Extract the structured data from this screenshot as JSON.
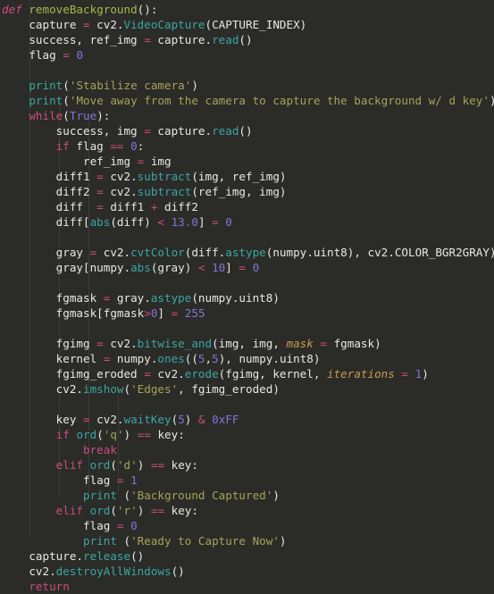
{
  "editor": {
    "language": "Python",
    "background_color": "#2b2b28",
    "foreground_color": "#e8e8e3",
    "font_size_px": 12.6,
    "line_height_px": 17,
    "theme_colors": {
      "keyword": "#cc4e7e",
      "function_name": "#a9b84a",
      "method_call": "#3ba7a0",
      "string": "#a5a458",
      "number": "#8675d6",
      "operator": "#cc4e7e",
      "keyword_argument": "#c99a4e",
      "plain_text": "#e8e8e3",
      "indent_guide": "#3b3b37"
    }
  },
  "code": {
    "lines": [
      [
        {
          "t": "def",
          "c": "kw-i"
        },
        {
          "t": " ",
          "c": "plain"
        },
        {
          "t": "removeBackground",
          "c": "fn"
        },
        {
          "t": "():",
          "c": "punct"
        }
      ],
      [
        {
          "t": "    capture ",
          "c": "plain"
        },
        {
          "t": "=",
          "c": "op"
        },
        {
          "t": " cv2.",
          "c": "plain"
        },
        {
          "t": "VideoCapture",
          "c": "meth"
        },
        {
          "t": "(CAPTURE_INDEX)",
          "c": "plain"
        }
      ],
      [
        {
          "t": "    success, ref_img ",
          "c": "plain"
        },
        {
          "t": "=",
          "c": "op"
        },
        {
          "t": " capture.",
          "c": "plain"
        },
        {
          "t": "read",
          "c": "meth"
        },
        {
          "t": "()",
          "c": "plain"
        }
      ],
      [
        {
          "t": "    flag ",
          "c": "plain"
        },
        {
          "t": "=",
          "c": "op"
        },
        {
          "t": " ",
          "c": "plain"
        },
        {
          "t": "0",
          "c": "num"
        }
      ],
      [],
      [
        {
          "t": "    ",
          "c": "plain"
        },
        {
          "t": "print",
          "c": "meth"
        },
        {
          "t": "(",
          "c": "plain"
        },
        {
          "t": "'Stabilize camera'",
          "c": "str"
        },
        {
          "t": ")",
          "c": "plain"
        }
      ],
      [
        {
          "t": "    ",
          "c": "plain"
        },
        {
          "t": "print",
          "c": "meth"
        },
        {
          "t": "(",
          "c": "plain"
        },
        {
          "t": "'Move away from the camera to capture the background w/ d key'",
          "c": "str"
        },
        {
          "t": ")",
          "c": "plain"
        }
      ],
      [
        {
          "t": "    ",
          "c": "plain"
        },
        {
          "t": "while",
          "c": "kw"
        },
        {
          "t": "(",
          "c": "plain"
        },
        {
          "t": "True",
          "c": "const"
        },
        {
          "t": "):",
          "c": "plain"
        }
      ],
      [
        {
          "t": "        success, img ",
          "c": "plain"
        },
        {
          "t": "=",
          "c": "op"
        },
        {
          "t": " capture.",
          "c": "plain"
        },
        {
          "t": "read",
          "c": "meth"
        },
        {
          "t": "()",
          "c": "plain"
        }
      ],
      [
        {
          "t": "        ",
          "c": "plain"
        },
        {
          "t": "if",
          "c": "kw"
        },
        {
          "t": " flag ",
          "c": "plain"
        },
        {
          "t": "==",
          "c": "op"
        },
        {
          "t": " ",
          "c": "plain"
        },
        {
          "t": "0",
          "c": "num"
        },
        {
          "t": ":",
          "c": "plain"
        }
      ],
      [
        {
          "t": "            ref_img ",
          "c": "plain"
        },
        {
          "t": "=",
          "c": "op"
        },
        {
          "t": " img",
          "c": "plain"
        }
      ],
      [
        {
          "t": "        diff1 ",
          "c": "plain"
        },
        {
          "t": "=",
          "c": "op"
        },
        {
          "t": " cv2.",
          "c": "plain"
        },
        {
          "t": "subtract",
          "c": "meth"
        },
        {
          "t": "(img, ref_img)",
          "c": "plain"
        }
      ],
      [
        {
          "t": "        diff2 ",
          "c": "plain"
        },
        {
          "t": "=",
          "c": "op"
        },
        {
          "t": " cv2.",
          "c": "plain"
        },
        {
          "t": "subtract",
          "c": "meth"
        },
        {
          "t": "(ref_img, img)",
          "c": "plain"
        }
      ],
      [
        {
          "t": "        diff  ",
          "c": "plain"
        },
        {
          "t": "=",
          "c": "op"
        },
        {
          "t": " diff1 ",
          "c": "plain"
        },
        {
          "t": "+",
          "c": "op"
        },
        {
          "t": " diff2",
          "c": "plain"
        }
      ],
      [
        {
          "t": "        diff[",
          "c": "plain"
        },
        {
          "t": "abs",
          "c": "meth"
        },
        {
          "t": "(diff) ",
          "c": "plain"
        },
        {
          "t": "<",
          "c": "op"
        },
        {
          "t": " ",
          "c": "plain"
        },
        {
          "t": "13.0",
          "c": "num"
        },
        {
          "t": "] ",
          "c": "plain"
        },
        {
          "t": "=",
          "c": "op"
        },
        {
          "t": " ",
          "c": "plain"
        },
        {
          "t": "0",
          "c": "num"
        }
      ],
      [],
      [
        {
          "t": "        gray ",
          "c": "plain"
        },
        {
          "t": "=",
          "c": "op"
        },
        {
          "t": " cv2.",
          "c": "plain"
        },
        {
          "t": "cvtColor",
          "c": "meth"
        },
        {
          "t": "(diff.",
          "c": "plain"
        },
        {
          "t": "astype",
          "c": "meth"
        },
        {
          "t": "(numpy.uint8), cv2.COLOR_BGR2GRAY)",
          "c": "plain"
        }
      ],
      [
        {
          "t": "        gray[numpy.",
          "c": "plain"
        },
        {
          "t": "abs",
          "c": "meth"
        },
        {
          "t": "(gray) ",
          "c": "plain"
        },
        {
          "t": "<",
          "c": "op"
        },
        {
          "t": " ",
          "c": "plain"
        },
        {
          "t": "10",
          "c": "num"
        },
        {
          "t": "] ",
          "c": "plain"
        },
        {
          "t": "=",
          "c": "op"
        },
        {
          "t": " ",
          "c": "plain"
        },
        {
          "t": "0",
          "c": "num"
        }
      ],
      [],
      [
        {
          "t": "        fgmask ",
          "c": "plain"
        },
        {
          "t": "=",
          "c": "op"
        },
        {
          "t": " gray.",
          "c": "plain"
        },
        {
          "t": "astype",
          "c": "meth"
        },
        {
          "t": "(numpy.uint8)",
          "c": "plain"
        }
      ],
      [
        {
          "t": "        fgmask[fgmask",
          "c": "plain"
        },
        {
          "t": ">",
          "c": "op"
        },
        {
          "t": "0",
          "c": "num"
        },
        {
          "t": "] ",
          "c": "plain"
        },
        {
          "t": "=",
          "c": "op"
        },
        {
          "t": " ",
          "c": "plain"
        },
        {
          "t": "255",
          "c": "num"
        }
      ],
      [],
      [
        {
          "t": "        fgimg ",
          "c": "plain"
        },
        {
          "t": "=",
          "c": "op"
        },
        {
          "t": " cv2.",
          "c": "plain"
        },
        {
          "t": "bitwise_and",
          "c": "meth"
        },
        {
          "t": "(img, img, ",
          "c": "plain"
        },
        {
          "t": "mask",
          "c": "kwarg"
        },
        {
          "t": " ",
          "c": "plain"
        },
        {
          "t": "=",
          "c": "op"
        },
        {
          "t": " fgmask)",
          "c": "plain"
        }
      ],
      [
        {
          "t": "        kernel ",
          "c": "plain"
        },
        {
          "t": "=",
          "c": "op"
        },
        {
          "t": " numpy.",
          "c": "plain"
        },
        {
          "t": "ones",
          "c": "meth"
        },
        {
          "t": "((",
          "c": "plain"
        },
        {
          "t": "5",
          "c": "num"
        },
        {
          "t": ",",
          "c": "plain"
        },
        {
          "t": "5",
          "c": "num"
        },
        {
          "t": "), numpy.uint8)",
          "c": "plain"
        }
      ],
      [
        {
          "t": "        fgimg_eroded ",
          "c": "plain"
        },
        {
          "t": "=",
          "c": "op"
        },
        {
          "t": " cv2.",
          "c": "plain"
        },
        {
          "t": "erode",
          "c": "meth"
        },
        {
          "t": "(fgimg, kernel, ",
          "c": "plain"
        },
        {
          "t": "iterations",
          "c": "kwarg"
        },
        {
          "t": " ",
          "c": "plain"
        },
        {
          "t": "=",
          "c": "op"
        },
        {
          "t": " ",
          "c": "plain"
        },
        {
          "t": "1",
          "c": "num"
        },
        {
          "t": ")",
          "c": "plain"
        }
      ],
      [
        {
          "t": "        cv2.",
          "c": "plain"
        },
        {
          "t": "imshow",
          "c": "meth"
        },
        {
          "t": "(",
          "c": "plain"
        },
        {
          "t": "'Edges'",
          "c": "str"
        },
        {
          "t": ", fgimg_eroded)",
          "c": "plain"
        }
      ],
      [],
      [
        {
          "t": "        key ",
          "c": "plain"
        },
        {
          "t": "=",
          "c": "op"
        },
        {
          "t": " cv2.",
          "c": "plain"
        },
        {
          "t": "waitKey",
          "c": "meth"
        },
        {
          "t": "(",
          "c": "plain"
        },
        {
          "t": "5",
          "c": "num"
        },
        {
          "t": ") ",
          "c": "plain"
        },
        {
          "t": "&",
          "c": "op"
        },
        {
          "t": " ",
          "c": "plain"
        },
        {
          "t": "0xFF",
          "c": "num"
        }
      ],
      [
        {
          "t": "        ",
          "c": "plain"
        },
        {
          "t": "if",
          "c": "kw"
        },
        {
          "t": " ",
          "c": "plain"
        },
        {
          "t": "ord",
          "c": "meth"
        },
        {
          "t": "(",
          "c": "plain"
        },
        {
          "t": "'q'",
          "c": "str"
        },
        {
          "t": ") ",
          "c": "plain"
        },
        {
          "t": "==",
          "c": "op"
        },
        {
          "t": " key:",
          "c": "plain"
        }
      ],
      [
        {
          "t": "            ",
          "c": "plain"
        },
        {
          "t": "break",
          "c": "kw"
        }
      ],
      [
        {
          "t": "        ",
          "c": "plain"
        },
        {
          "t": "elif",
          "c": "kw"
        },
        {
          "t": " ",
          "c": "plain"
        },
        {
          "t": "ord",
          "c": "meth"
        },
        {
          "t": "(",
          "c": "plain"
        },
        {
          "t": "'d'",
          "c": "str"
        },
        {
          "t": ") ",
          "c": "plain"
        },
        {
          "t": "==",
          "c": "op"
        },
        {
          "t": " key:",
          "c": "plain"
        }
      ],
      [
        {
          "t": "            flag ",
          "c": "plain"
        },
        {
          "t": "=",
          "c": "op"
        },
        {
          "t": " ",
          "c": "plain"
        },
        {
          "t": "1",
          "c": "num"
        }
      ],
      [
        {
          "t": "            ",
          "c": "plain"
        },
        {
          "t": "print",
          "c": "meth"
        },
        {
          "t": " (",
          "c": "plain"
        },
        {
          "t": "'Background Captured'",
          "c": "str"
        },
        {
          "t": ")",
          "c": "plain"
        }
      ],
      [
        {
          "t": "        ",
          "c": "plain"
        },
        {
          "t": "elif",
          "c": "kw"
        },
        {
          "t": " ",
          "c": "plain"
        },
        {
          "t": "ord",
          "c": "meth"
        },
        {
          "t": "(",
          "c": "plain"
        },
        {
          "t": "'r'",
          "c": "str"
        },
        {
          "t": ") ",
          "c": "plain"
        },
        {
          "t": "==",
          "c": "op"
        },
        {
          "t": " key:",
          "c": "plain"
        }
      ],
      [
        {
          "t": "            flag ",
          "c": "plain"
        },
        {
          "t": "=",
          "c": "op"
        },
        {
          "t": " ",
          "c": "plain"
        },
        {
          "t": "0",
          "c": "num"
        }
      ],
      [
        {
          "t": "            ",
          "c": "plain"
        },
        {
          "t": "print",
          "c": "meth"
        },
        {
          "t": " (",
          "c": "plain"
        },
        {
          "t": "'Ready to Capture Now'",
          "c": "str"
        },
        {
          "t": ")",
          "c": "plain"
        }
      ],
      [
        {
          "t": "    capture.",
          "c": "plain"
        },
        {
          "t": "release",
          "c": "meth"
        },
        {
          "t": "()",
          "c": "plain"
        }
      ],
      [
        {
          "t": "    cv2.",
          "c": "plain"
        },
        {
          "t": "destroyAllWindows",
          "c": "meth"
        },
        {
          "t": "()",
          "c": "plain"
        }
      ],
      [
        {
          "t": "    ",
          "c": "plain"
        },
        {
          "t": "return",
          "c": "kw"
        }
      ]
    ],
    "plain_text": "def removeBackground():\n    capture = cv2.VideoCapture(CAPTURE_INDEX)\n    success, ref_img = capture.read()\n    flag = 0\n\n    print('Stabilize camera')\n    print('Move away from the camera to capture the background w/ d key')\n    while(True):\n        success, img = capture.read()\n        if flag == 0:\n            ref_img = img\n        diff1 = cv2.subtract(img, ref_img)\n        diff2 = cv2.subtract(ref_img, img)\n        diff  = diff1 + diff2\n        diff[abs(diff) < 13.0] = 0\n\n        gray = cv2.cvtColor(diff.astype(numpy.uint8), cv2.COLOR_BGR2GRAY)\n        gray[numpy.abs(gray) < 10] = 0\n\n        fgmask = gray.astype(numpy.uint8)\n        fgmask[fgmask>0] = 255\n\n        fgimg = cv2.bitwise_and(img, img, mask = fgmask)\n        kernel = numpy.ones((5,5), numpy.uint8)\n        fgimg_eroded = cv2.erode(fgimg, kernel, iterations = 1)\n        cv2.imshow('Edges', fgimg_eroded)\n\n        key = cv2.waitKey(5) & 0xFF\n        if ord('q') == key:\n            break\n        elif ord('d') == key:\n            flag = 1\n            print ('Background Captured')\n        elif ord('r') == key:\n            flag = 0\n            print ('Ready to Capture Now')\n    capture.release()\n    cv2.destroyAllWindows()\n    return"
  }
}
